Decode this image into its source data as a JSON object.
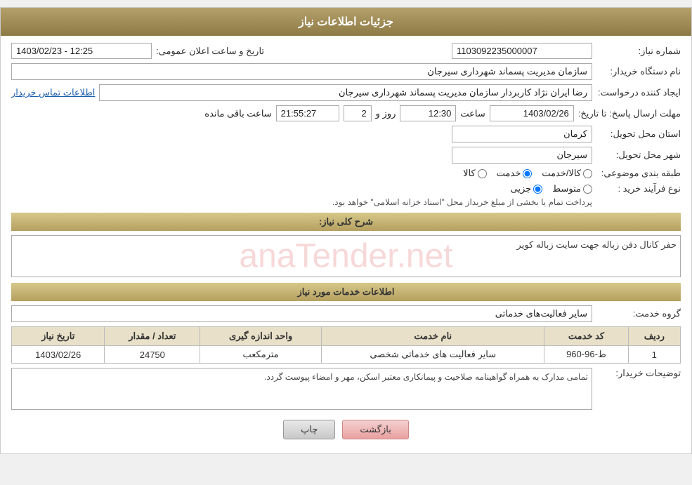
{
  "page": {
    "title": "جزئیات اطلاعات نیاز",
    "header": {
      "label": "جزئیات اطلاعات نیاز"
    }
  },
  "form": {
    "shomareNiaz_label": "شماره نیاز:",
    "shomareNiaz_value": "1103092235000007",
    "namDastgah_label": "نام دستگاه خریدار:",
    "namDastgah_value": "سازمان مدیریت پسماند شهرداری سیرجان",
    "tarikh_label": "تاریخ و ساعت اعلان عمومی:",
    "tarikh_value": "1403/02/23 - 12:25",
    "ijadKonande_label": "ایجاد کننده درخواست:",
    "ijadKonande_value": "رضا ایران نژاد کاربردار سازمان مدیریت پسماند شهرداری سیرجان",
    "etelaat_link": "اطلاعات تماس خریدار",
    "mohlatErsal_label": "مهلت ارسال پاسخ: تا تاریخ:",
    "mohlatErsal_date": "1403/02/26",
    "mohlatErsal_saat_label": "ساعت",
    "mohlatErsal_saat_value": "12:30",
    "mohlatErsal_roz_label": "روز و",
    "mohlatErsal_roz_value": "2",
    "mohlatErsal_mande_label": "ساعت باقی مانده",
    "mohlatErsal_mande_value": "21:55:27",
    "ostan_label": "استان محل تحویل:",
    "ostan_value": "کرمان",
    "shahr_label": "شهر محل تحویل:",
    "shahr_value": "سیرجان",
    "tabaqe_label": "طبقه بندی موضوعی:",
    "tabaqe_kala": "کالا",
    "tabaqe_khedmat": "خدمت",
    "tabaqe_kala_khedmat": "کالا/خدمت",
    "tabaqe_selected": "khedmat",
    "noeFarayand_label": "نوع فرآیند خرید :",
    "noeFarayand_jozi": "جزیی",
    "noeFarayand_mottaset": "متوسط",
    "noeFarayand_note": "پرداخت تمام یا بخشی از مبلغ خریداز محل \"اسناد خزانه اسلامی\" خواهد بود.",
    "noeFarayand_selected": "jozi",
    "sharh_label": "شرح کلی نیاز:",
    "sharh_value": "حفر کانال دفن زباله جهت سایت زباله کویر",
    "services_section_label": "اطلاعات خدمات مورد نیاز",
    "groheKhedmat_label": "گروه خدمت:",
    "groheKhedmat_value": "سایر فعالیت‌های خدماتی",
    "table": {
      "headers": [
        "ردیف",
        "کد خدمت",
        "نام خدمت",
        "واحد اندازه گیری",
        "تعداد / مقدار",
        "تاریخ نیاز"
      ],
      "rows": [
        {
          "radif": "1",
          "kodKhedmat": "ط-96-960",
          "namKhedmat": "سایر فعالیت های خدماتی شخصی",
          "vahed": "مترمکعب",
          "tedad": "24750",
          "tarikh": "1403/02/26"
        }
      ]
    },
    "tozihat_label": "توضیحات خریدار:",
    "tozihat_value": "تمامی مدارک به همراه گواهینامه صلاحیت و پیمانکاری معتبر اسکن، مهر و امضاء پیوست گردد.",
    "btn_print": "چاپ",
    "btn_back": "بازگشت"
  }
}
